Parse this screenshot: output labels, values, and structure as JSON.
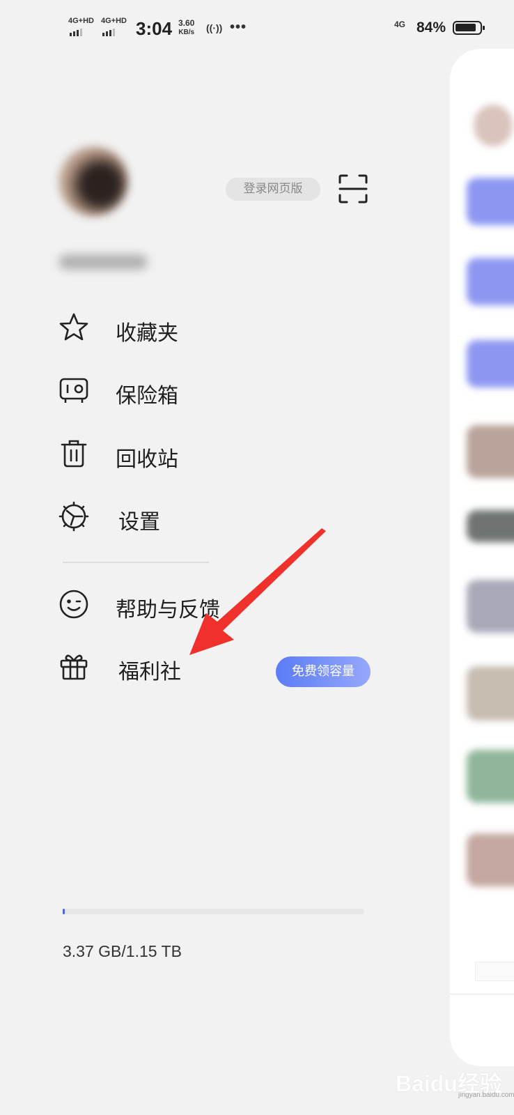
{
  "status_bar": {
    "signal_1": "4G+HD",
    "signal_2": "4G+HD",
    "time": "3:04",
    "speed_value": "3.60",
    "speed_unit": "KB/s",
    "hotspot": "((·))",
    "more": "•••",
    "network_right": "4G",
    "battery_percent": "84%",
    "battery_level": 0.84
  },
  "profile": {
    "login_web_label": "登录网页版"
  },
  "menu": {
    "favorites": "收藏夹",
    "safe_box": "保险箱",
    "recycle_bin": "回收站",
    "settings": "设置",
    "help_feedback": "帮助与反馈",
    "welfare": "福利社",
    "welfare_badge": "免费领容量"
  },
  "storage": {
    "text": "3.37 GB/1.15 TB",
    "used_fraction": 0.003
  },
  "watermark": {
    "brand": "Baidu经验",
    "site": "jingyan.baidu.com"
  },
  "colors": {
    "background": "#f2f2f2",
    "accent_blue": "#5b7cf6",
    "arrow_red": "#f0302a"
  }
}
